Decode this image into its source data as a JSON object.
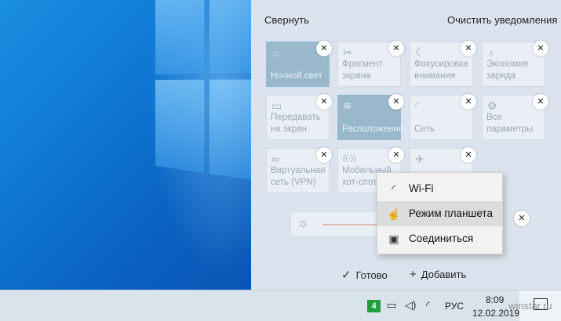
{
  "action_center": {
    "collapse_label": "Свернуть",
    "clear_label": "Очистить уведомления",
    "tiles": [
      {
        "label": "Ночной свет",
        "icon": "night-light-icon",
        "glyph": "☼",
        "on": true
      },
      {
        "label": "Фрагмент экрана",
        "icon": "screen-snip-icon",
        "glyph": "✂",
        "on": false
      },
      {
        "label": "Фокусировка внимания",
        "icon": "focus-assist-icon",
        "glyph": "☾",
        "on": false
      },
      {
        "label": "Экономия заряда",
        "icon": "battery-saver-icon",
        "glyph": "♁",
        "on": false
      },
      {
        "label": "Передавать на экран",
        "icon": "project-icon",
        "glyph": "▭",
        "on": false
      },
      {
        "label": "Расположение",
        "icon": "location-icon",
        "glyph": "⛯",
        "on": true
      },
      {
        "label": "Сеть",
        "icon": "network-icon",
        "glyph": "◜",
        "on": false
      },
      {
        "label": "Все параметры",
        "icon": "settings-gear-icon",
        "glyph": "⚙",
        "on": false
      },
      {
        "label": "Виртуальная сеть (VPN)",
        "icon": "vpn-icon",
        "glyph": "∞",
        "on": false
      },
      {
        "label": "Мобильный хот-спот",
        "icon": "hotspot-icon",
        "glyph": "((·))",
        "on": false
      },
      {
        "label": "",
        "icon": "airplane-mode-icon",
        "glyph": "✈",
        "on": false
      }
    ],
    "brightness_icon": "☼",
    "done_label": "Готово",
    "add_label": "Добавить"
  },
  "context_menu": {
    "items": [
      {
        "label": "Wi-Fi",
        "icon": "wifi-icon",
        "glyph": "◜"
      },
      {
        "label": "Режим планшета",
        "icon": "tablet-mode-icon",
        "glyph": "☝"
      },
      {
        "label": "Соединиться",
        "icon": "connect-icon",
        "glyph": "▣"
      }
    ]
  },
  "taskbar": {
    "badge": "4",
    "language": "РУС",
    "time": "8:09",
    "date": "12.02.2019"
  },
  "watermark": "winstar.ru",
  "colors": {
    "tile_on": "#9ab8cc",
    "tile_off": "#e9eff5",
    "action_center_bg": "#dbe4ee",
    "badge_green": "#1f9e3a"
  }
}
